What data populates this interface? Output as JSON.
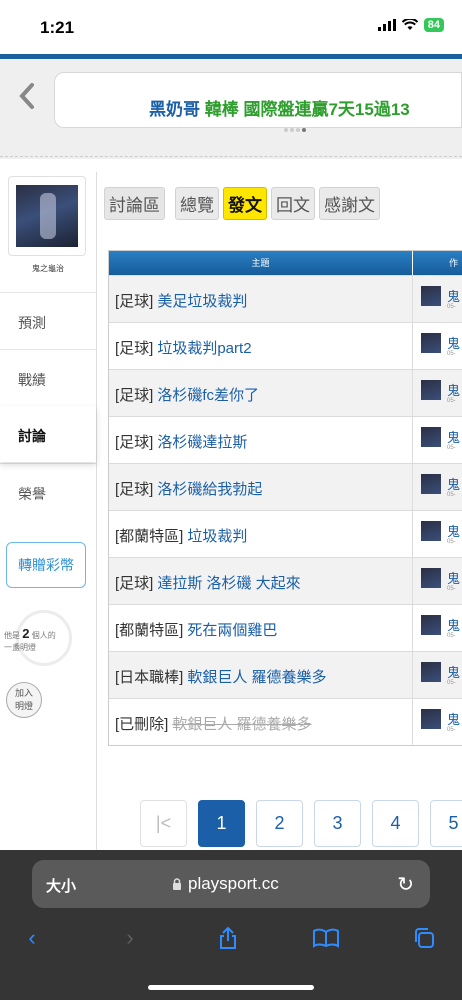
{
  "status": {
    "time": "1:21",
    "battery": "84"
  },
  "marquee": {
    "part1": "黑奶哥",
    "part2": "韓棒 國際盤連贏7天15過13"
  },
  "sidebar": {
    "username": "鬼之龜治",
    "items": [
      {
        "label": "預測"
      },
      {
        "label": "戰績"
      },
      {
        "label": "討論"
      },
      {
        "label": "榮譽"
      }
    ],
    "gift_label": "轉贈彩幣",
    "bulb_pre": "他是",
    "bulb_count": "2",
    "bulb_post": "個人的",
    "bulb_line2": "一盞明燈",
    "join_line1": "加入",
    "join_line2": "明燈"
  },
  "tabs": {
    "crumb": "討論區",
    "overview": "總覽",
    "post": "發文",
    "reply": "回文",
    "thanks": "感謝文"
  },
  "table": {
    "header_subject": "主題",
    "header_author": "作",
    "rows": [
      {
        "cat": "[足球]",
        "title": "美足垃圾裁判",
        "author": "鬼",
        "date": "05-"
      },
      {
        "cat": "[足球]",
        "title": "垃圾裁判part2",
        "author": "鬼",
        "date": "05-"
      },
      {
        "cat": "[足球]",
        "title": "洛杉磯fc差你了",
        "author": "鬼",
        "date": "05-"
      },
      {
        "cat": "[足球]",
        "title": "洛杉磯達拉斯",
        "author": "鬼",
        "date": "05-"
      },
      {
        "cat": "[足球]",
        "title": "洛杉磯給我勃起",
        "author": "鬼",
        "date": "05-"
      },
      {
        "cat": "[都蘭特區]",
        "title": "垃圾裁判",
        "author": "鬼",
        "date": "05-"
      },
      {
        "cat": "[足球]",
        "title": "達拉斯 洛杉磯 大起來",
        "author": "鬼",
        "date": "05-"
      },
      {
        "cat": "[都蘭特區]",
        "title": "死在兩個雞巴",
        "author": "鬼",
        "date": "05-"
      },
      {
        "cat": "[日本職棒]",
        "title": "軟銀巨人 羅德養樂多",
        "author": "鬼",
        "date": "05-"
      },
      {
        "cat": "[已刪除]",
        "title": "軟銀巨人 羅德養樂多",
        "author": "鬼",
        "date": "05-"
      }
    ]
  },
  "pagination": {
    "first": "|<",
    "p1": "1",
    "p2": "2",
    "p3": "3",
    "p4": "4",
    "p5": "5"
  },
  "browser": {
    "size_label": "大小",
    "url": "playsport.cc"
  },
  "colors": {
    "accent": "#1a5fa8",
    "active_tab": "#ffe600",
    "marquee_green": "#2e9e2e"
  }
}
